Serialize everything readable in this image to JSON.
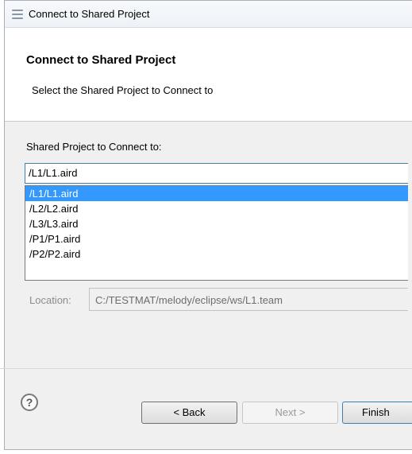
{
  "window": {
    "title": "Connect to Shared Project"
  },
  "header": {
    "title": "Connect to Shared Project",
    "description": "Select the Shared Project to Connect to"
  },
  "form": {
    "label": "Shared Project to Connect to:",
    "selected_value": "/L1/L1.aird",
    "options": [
      "/L1/L1.aird",
      "/L2/L2.aird",
      "/L3/L3.aird",
      "/P1/P1.aird",
      "/P2/P2.aird"
    ],
    "highlighted_index": 0,
    "location_label": "Location:",
    "location_value": "C:/TESTMAT/melody/eclipse/ws/L1.team"
  },
  "buttons": {
    "help": "?",
    "back": "< Back",
    "next": "Next >",
    "finish": "Finish"
  },
  "colors": {
    "selection": "#3399ff",
    "focus_border": "#3c7fb1"
  }
}
